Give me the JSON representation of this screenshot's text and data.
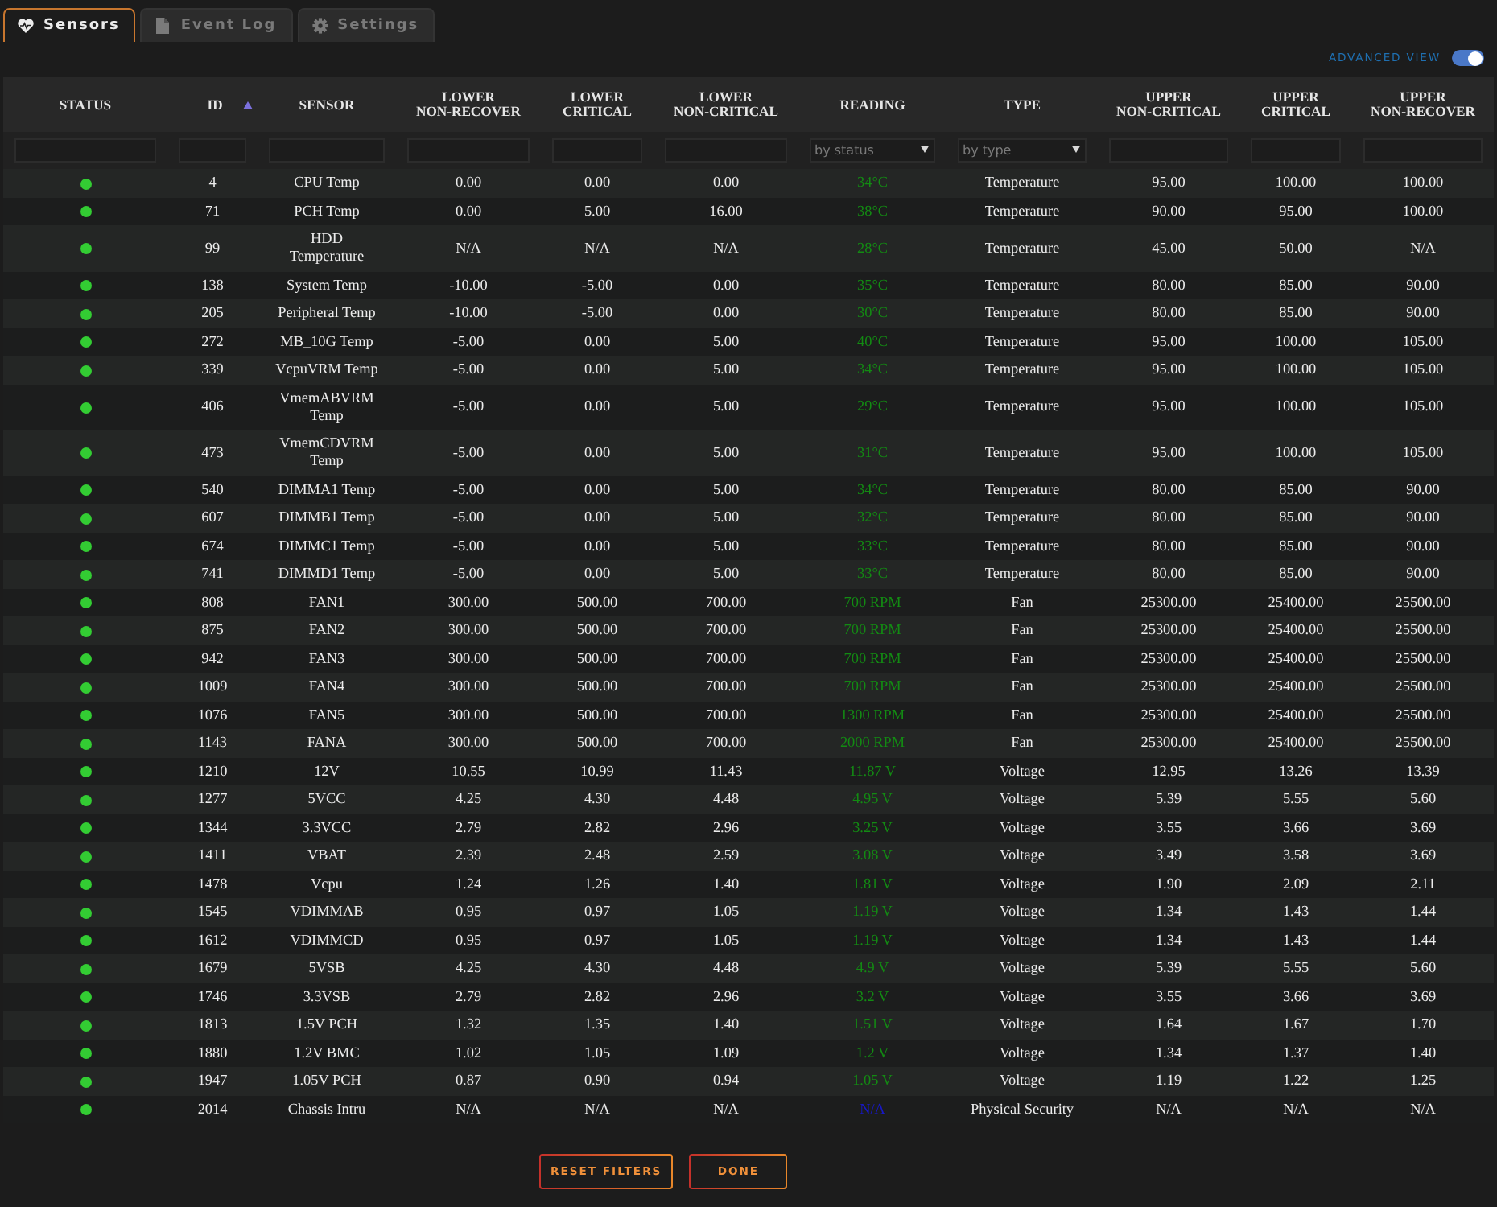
{
  "tabs": [
    {
      "label": "Sensors",
      "selected": true
    },
    {
      "label": "Event Log",
      "selected": false
    },
    {
      "label": "Settings",
      "selected": false
    }
  ],
  "advanced_view": {
    "label": "ADVANCED VIEW",
    "on": true
  },
  "table": {
    "columns": [
      {
        "label": "STATUS",
        "sorted": false,
        "filter": {
          "kind": "field"
        }
      },
      {
        "label": "ID",
        "sorted": true,
        "filter": {
          "kind": "field"
        }
      },
      {
        "label": "SENSOR",
        "sorted": false,
        "filter": {
          "kind": "field"
        }
      },
      {
        "label": "LOWER\nNON-RECOVER",
        "sorted": false,
        "filter": {
          "kind": "field"
        }
      },
      {
        "label": "LOWER\nCRITICAL",
        "sorted": false,
        "filter": {
          "kind": "field"
        }
      },
      {
        "label": "LOWER\nNON-CRITICAL",
        "sorted": false,
        "filter": {
          "kind": "field"
        }
      },
      {
        "label": "READING",
        "sorted": false,
        "filter": {
          "kind": "dropdown",
          "placeholder": "by status"
        }
      },
      {
        "label": "TYPE",
        "sorted": false,
        "filter": {
          "kind": "dropdown",
          "placeholder": "by type"
        }
      },
      {
        "label": "UPPER\nNON-CRITICAL",
        "sorted": false,
        "filter": {
          "kind": "field"
        }
      },
      {
        "label": "UPPER\nCRITICAL",
        "sorted": false,
        "filter": {
          "kind": "field"
        }
      },
      {
        "label": "UPPER\nNON-RECOVER",
        "sorted": false,
        "filter": {
          "kind": "field"
        }
      }
    ],
    "rows": [
      {
        "color": "#33cc33",
        "id": "4",
        "sensor": "CPU Temp",
        "lower_non_recover": "0.00",
        "lower_critical": "0.00",
        "lower_non_critical": "0.00",
        "reading": {
          "text": "34°C",
          "color": "#138a13"
        },
        "type": "Temperature",
        "upper_non_critical": "95.00",
        "upper_critical": "100.00",
        "upper_non_recover": "100.00"
      },
      {
        "color": "#33cc33",
        "id": "71",
        "sensor": "PCH Temp",
        "lower_non_recover": "0.00",
        "lower_critical": "5.00",
        "lower_non_critical": "16.00",
        "reading": {
          "text": "38°C",
          "color": "#138a13"
        },
        "type": "Temperature",
        "upper_non_critical": "90.00",
        "upper_critical": "95.00",
        "upper_non_recover": "100.00"
      },
      {
        "color": "#33cc33",
        "id": "99",
        "sensor": "HDD Temperature",
        "lower_non_recover": "N/A",
        "lower_critical": "N/A",
        "lower_non_critical": "N/A",
        "reading": {
          "text": "28°C",
          "color": "#138a13"
        },
        "type": "Temperature",
        "upper_non_critical": "45.00",
        "upper_critical": "50.00",
        "upper_non_recover": "N/A"
      },
      {
        "color": "#33cc33",
        "id": "138",
        "sensor": "System Temp",
        "lower_non_recover": "-10.00",
        "lower_critical": "-5.00",
        "lower_non_critical": "0.00",
        "reading": {
          "text": "35°C",
          "color": "#138a13"
        },
        "type": "Temperature",
        "upper_non_critical": "80.00",
        "upper_critical": "85.00",
        "upper_non_recover": "90.00"
      },
      {
        "color": "#33cc33",
        "id": "205",
        "sensor": "Peripheral Temp",
        "lower_non_recover": "-10.00",
        "lower_critical": "-5.00",
        "lower_non_critical": "0.00",
        "reading": {
          "text": "30°C",
          "color": "#138a13"
        },
        "type": "Temperature",
        "upper_non_critical": "80.00",
        "upper_critical": "85.00",
        "upper_non_recover": "90.00"
      },
      {
        "color": "#33cc33",
        "id": "272",
        "sensor": "MB_10G Temp",
        "lower_non_recover": "-5.00",
        "lower_critical": "0.00",
        "lower_non_critical": "5.00",
        "reading": {
          "text": "40°C",
          "color": "#138a13"
        },
        "type": "Temperature",
        "upper_non_critical": "95.00",
        "upper_critical": "100.00",
        "upper_non_recover": "105.00"
      },
      {
        "color": "#33cc33",
        "id": "339",
        "sensor": "VcpuVRM Temp",
        "lower_non_recover": "-5.00",
        "lower_critical": "0.00",
        "lower_non_critical": "5.00",
        "reading": {
          "text": "34°C",
          "color": "#138a13"
        },
        "type": "Temperature",
        "upper_non_critical": "95.00",
        "upper_critical": "100.00",
        "upper_non_recover": "105.00"
      },
      {
        "color": "#33cc33",
        "id": "406",
        "sensor": "VmemABVRM Temp",
        "lower_non_recover": "-5.00",
        "lower_critical": "0.00",
        "lower_non_critical": "5.00",
        "reading": {
          "text": "29°C",
          "color": "#138a13"
        },
        "type": "Temperature",
        "upper_non_critical": "95.00",
        "upper_critical": "100.00",
        "upper_non_recover": "105.00"
      },
      {
        "color": "#33cc33",
        "id": "473",
        "sensor": "VmemCDVRM Temp",
        "lower_non_recover": "-5.00",
        "lower_critical": "0.00",
        "lower_non_critical": "5.00",
        "reading": {
          "text": "31°C",
          "color": "#138a13"
        },
        "type": "Temperature",
        "upper_non_critical": "95.00",
        "upper_critical": "100.00",
        "upper_non_recover": "105.00"
      },
      {
        "color": "#33cc33",
        "id": "540",
        "sensor": "DIMMA1 Temp",
        "lower_non_recover": "-5.00",
        "lower_critical": "0.00",
        "lower_non_critical": "5.00",
        "reading": {
          "text": "34°C",
          "color": "#138a13"
        },
        "type": "Temperature",
        "upper_non_critical": "80.00",
        "upper_critical": "85.00",
        "upper_non_recover": "90.00"
      },
      {
        "color": "#33cc33",
        "id": "607",
        "sensor": "DIMMB1 Temp",
        "lower_non_recover": "-5.00",
        "lower_critical": "0.00",
        "lower_non_critical": "5.00",
        "reading": {
          "text": "32°C",
          "color": "#138a13"
        },
        "type": "Temperature",
        "upper_non_critical": "80.00",
        "upper_critical": "85.00",
        "upper_non_recover": "90.00"
      },
      {
        "color": "#33cc33",
        "id": "674",
        "sensor": "DIMMC1 Temp",
        "lower_non_recover": "-5.00",
        "lower_critical": "0.00",
        "lower_non_critical": "5.00",
        "reading": {
          "text": "33°C",
          "color": "#138a13"
        },
        "type": "Temperature",
        "upper_non_critical": "80.00",
        "upper_critical": "85.00",
        "upper_non_recover": "90.00"
      },
      {
        "color": "#33cc33",
        "id": "741",
        "sensor": "DIMMD1 Temp",
        "lower_non_recover": "-5.00",
        "lower_critical": "0.00",
        "lower_non_critical": "5.00",
        "reading": {
          "text": "33°C",
          "color": "#138a13"
        },
        "type": "Temperature",
        "upper_non_critical": "80.00",
        "upper_critical": "85.00",
        "upper_non_recover": "90.00"
      },
      {
        "color": "#33cc33",
        "id": "808",
        "sensor": "FAN1",
        "lower_non_recover": "300.00",
        "lower_critical": "500.00",
        "lower_non_critical": "700.00",
        "reading": {
          "text": "700 RPM",
          "color": "#138a13"
        },
        "type": "Fan",
        "upper_non_critical": "25300.00",
        "upper_critical": "25400.00",
        "upper_non_recover": "25500.00"
      },
      {
        "color": "#33cc33",
        "id": "875",
        "sensor": "FAN2",
        "lower_non_recover": "300.00",
        "lower_critical": "500.00",
        "lower_non_critical": "700.00",
        "reading": {
          "text": "700 RPM",
          "color": "#138a13"
        },
        "type": "Fan",
        "upper_non_critical": "25300.00",
        "upper_critical": "25400.00",
        "upper_non_recover": "25500.00"
      },
      {
        "color": "#33cc33",
        "id": "942",
        "sensor": "FAN3",
        "lower_non_recover": "300.00",
        "lower_critical": "500.00",
        "lower_non_critical": "700.00",
        "reading": {
          "text": "700 RPM",
          "color": "#138a13"
        },
        "type": "Fan",
        "upper_non_critical": "25300.00",
        "upper_critical": "25400.00",
        "upper_non_recover": "25500.00"
      },
      {
        "color": "#33cc33",
        "id": "1009",
        "sensor": "FAN4",
        "lower_non_recover": "300.00",
        "lower_critical": "500.00",
        "lower_non_critical": "700.00",
        "reading": {
          "text": "700 RPM",
          "color": "#138a13"
        },
        "type": "Fan",
        "upper_non_critical": "25300.00",
        "upper_critical": "25400.00",
        "upper_non_recover": "25500.00"
      },
      {
        "color": "#33cc33",
        "id": "1076",
        "sensor": "FAN5",
        "lower_non_recover": "300.00",
        "lower_critical": "500.00",
        "lower_non_critical": "700.00",
        "reading": {
          "text": "1300 RPM",
          "color": "#138a13"
        },
        "type": "Fan",
        "upper_non_critical": "25300.00",
        "upper_critical": "25400.00",
        "upper_non_recover": "25500.00"
      },
      {
        "color": "#33cc33",
        "id": "1143",
        "sensor": "FANA",
        "lower_non_recover": "300.00",
        "lower_critical": "500.00",
        "lower_non_critical": "700.00",
        "reading": {
          "text": "2000 RPM",
          "color": "#138a13"
        },
        "type": "Fan",
        "upper_non_critical": "25300.00",
        "upper_critical": "25400.00",
        "upper_non_recover": "25500.00"
      },
      {
        "color": "#33cc33",
        "id": "1210",
        "sensor": "12V",
        "lower_non_recover": "10.55",
        "lower_critical": "10.99",
        "lower_non_critical": "11.43",
        "reading": {
          "text": "11.87 V",
          "color": "#138a13"
        },
        "type": "Voltage",
        "upper_non_critical": "12.95",
        "upper_critical": "13.26",
        "upper_non_recover": "13.39"
      },
      {
        "color": "#33cc33",
        "id": "1277",
        "sensor": "5VCC",
        "lower_non_recover": "4.25",
        "lower_critical": "4.30",
        "lower_non_critical": "4.48",
        "reading": {
          "text": "4.95 V",
          "color": "#138a13"
        },
        "type": "Voltage",
        "upper_non_critical": "5.39",
        "upper_critical": "5.55",
        "upper_non_recover": "5.60"
      },
      {
        "color": "#33cc33",
        "id": "1344",
        "sensor": "3.3VCC",
        "lower_non_recover": "2.79",
        "lower_critical": "2.82",
        "lower_non_critical": "2.96",
        "reading": {
          "text": "3.25 V",
          "color": "#138a13"
        },
        "type": "Voltage",
        "upper_non_critical": "3.55",
        "upper_critical": "3.66",
        "upper_non_recover": "3.69"
      },
      {
        "color": "#33cc33",
        "id": "1411",
        "sensor": "VBAT",
        "lower_non_recover": "2.39",
        "lower_critical": "2.48",
        "lower_non_critical": "2.59",
        "reading": {
          "text": "3.08 V",
          "color": "#138a13"
        },
        "type": "Voltage",
        "upper_non_critical": "3.49",
        "upper_critical": "3.58",
        "upper_non_recover": "3.69"
      },
      {
        "color": "#33cc33",
        "id": "1478",
        "sensor": "Vcpu",
        "lower_non_recover": "1.24",
        "lower_critical": "1.26",
        "lower_non_critical": "1.40",
        "reading": {
          "text": "1.81 V",
          "color": "#138a13"
        },
        "type": "Voltage",
        "upper_non_critical": "1.90",
        "upper_critical": "2.09",
        "upper_non_recover": "2.11"
      },
      {
        "color": "#33cc33",
        "id": "1545",
        "sensor": "VDIMMAB",
        "lower_non_recover": "0.95",
        "lower_critical": "0.97",
        "lower_non_critical": "1.05",
        "reading": {
          "text": "1.19 V",
          "color": "#138a13"
        },
        "type": "Voltage",
        "upper_non_critical": "1.34",
        "upper_critical": "1.43",
        "upper_non_recover": "1.44"
      },
      {
        "color": "#33cc33",
        "id": "1612",
        "sensor": "VDIMMCD",
        "lower_non_recover": "0.95",
        "lower_critical": "0.97",
        "lower_non_critical": "1.05",
        "reading": {
          "text": "1.19 V",
          "color": "#138a13"
        },
        "type": "Voltage",
        "upper_non_critical": "1.34",
        "upper_critical": "1.43",
        "upper_non_recover": "1.44"
      },
      {
        "color": "#33cc33",
        "id": "1679",
        "sensor": "5VSB",
        "lower_non_recover": "4.25",
        "lower_critical": "4.30",
        "lower_non_critical": "4.48",
        "reading": {
          "text": "4.9 V",
          "color": "#138a13"
        },
        "type": "Voltage",
        "upper_non_critical": "5.39",
        "upper_critical": "5.55",
        "upper_non_recover": "5.60"
      },
      {
        "color": "#33cc33",
        "id": "1746",
        "sensor": "3.3VSB",
        "lower_non_recover": "2.79",
        "lower_critical": "2.82",
        "lower_non_critical": "2.96",
        "reading": {
          "text": "3.2 V",
          "color": "#138a13"
        },
        "type": "Voltage",
        "upper_non_critical": "3.55",
        "upper_critical": "3.66",
        "upper_non_recover": "3.69"
      },
      {
        "color": "#33cc33",
        "id": "1813",
        "sensor": "1.5V PCH",
        "lower_non_recover": "1.32",
        "lower_critical": "1.35",
        "lower_non_critical": "1.40",
        "reading": {
          "text": "1.51 V",
          "color": "#138a13"
        },
        "type": "Voltage",
        "upper_non_critical": "1.64",
        "upper_critical": "1.67",
        "upper_non_recover": "1.70"
      },
      {
        "color": "#33cc33",
        "id": "1880",
        "sensor": "1.2V BMC",
        "lower_non_recover": "1.02",
        "lower_critical": "1.05",
        "lower_non_critical": "1.09",
        "reading": {
          "text": "1.2 V",
          "color": "#138a13"
        },
        "type": "Voltage",
        "upper_non_critical": "1.34",
        "upper_critical": "1.37",
        "upper_non_recover": "1.40"
      },
      {
        "color": "#33cc33",
        "id": "1947",
        "sensor": "1.05V PCH",
        "lower_non_recover": "0.87",
        "lower_critical": "0.90",
        "lower_non_critical": "0.94",
        "reading": {
          "text": "1.05 V",
          "color": "#138a13"
        },
        "type": "Voltage",
        "upper_non_critical": "1.19",
        "upper_critical": "1.22",
        "upper_non_recover": "1.25"
      },
      {
        "color": "#33cc33",
        "id": "2014",
        "sensor": "Chassis Intru",
        "lower_non_recover": "N/A",
        "lower_critical": "N/A",
        "lower_non_critical": "N/A",
        "reading": {
          "text": "N/A",
          "color": "#1818c8"
        },
        "type": "Physical Security",
        "upper_non_critical": "N/A",
        "upper_critical": "N/A",
        "upper_non_recover": "N/A"
      }
    ]
  },
  "buttons": [
    {
      "label": "RESET FILTERS"
    },
    {
      "label": "DONE"
    }
  ]
}
